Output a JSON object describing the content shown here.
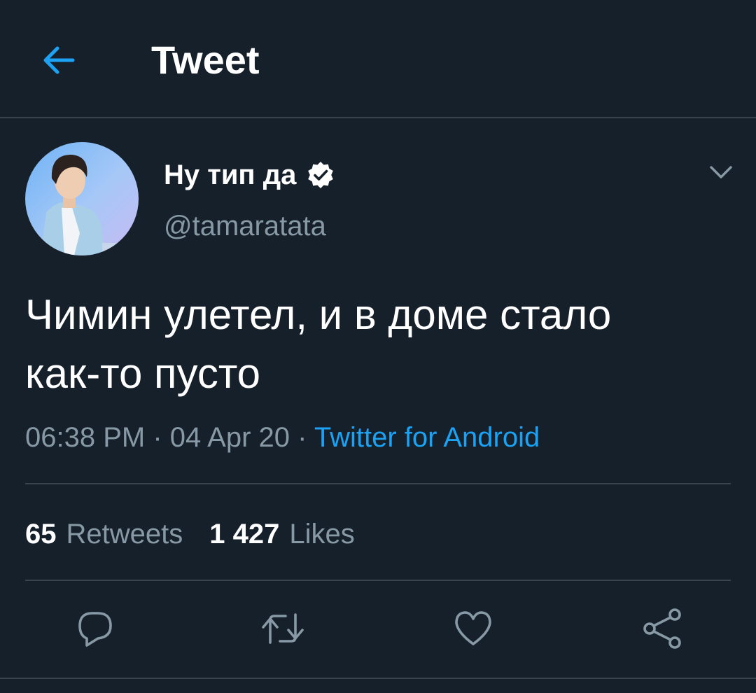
{
  "header": {
    "title": "Tweet",
    "back_icon": "arrow-left-icon"
  },
  "colors": {
    "background": "#15202b",
    "accent": "#1da1f2",
    "secondary_text": "#8899a6",
    "divider": "#38444d"
  },
  "tweet": {
    "author_name": "Ну тип да",
    "verified": true,
    "author_handle": "@tamaratata",
    "text": "Чимин улетел, и в доме стало\nкак-то пусто",
    "time": "06:38 PM",
    "date": "04 Apr 20",
    "separator": " · ",
    "source": "Twitter for Android"
  },
  "stats": {
    "retweets_count": "65",
    "retweets_label": "Retweets",
    "likes_count": "1 427",
    "likes_label": "Likes"
  },
  "actions": [
    "reply-icon",
    "retweet-icon",
    "like-icon",
    "share-icon"
  ]
}
